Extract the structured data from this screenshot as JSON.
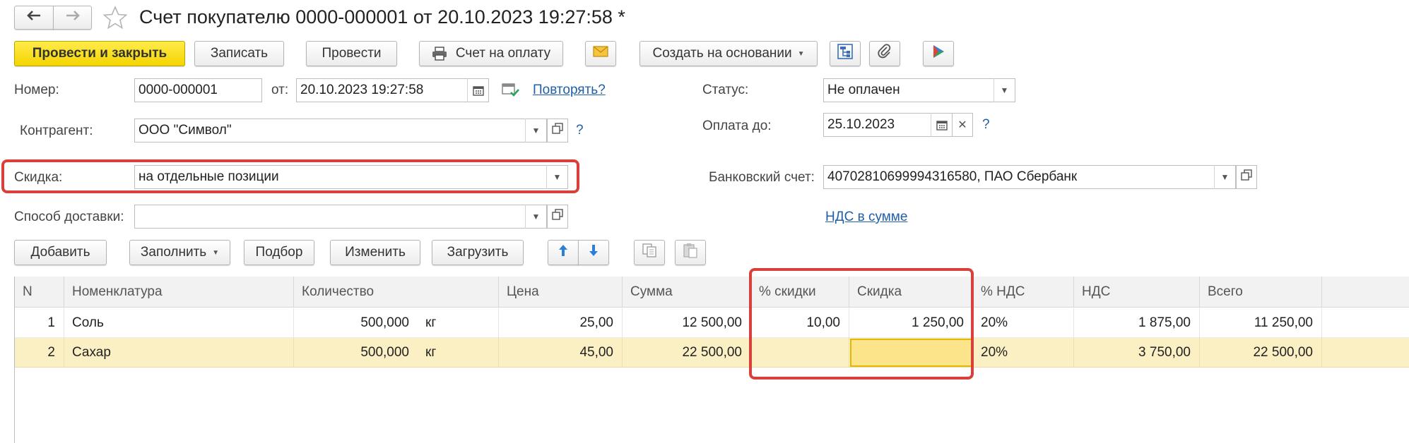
{
  "window": {
    "title": "Счет покупателю 0000-000001 от 20.10.2023 19:27:58 *"
  },
  "toolbar": {
    "post_close": "Провести и закрыть",
    "save": "Записать",
    "post": "Провести",
    "print_invoice": "Счет на оплату",
    "create_based": "Создать на основании"
  },
  "form": {
    "number_label": "Номер:",
    "number_value": "0000-000001",
    "date_label": "от:",
    "date_value": "20.10.2023 19:27:58",
    "repeat_link": "Повторять?",
    "status_label": "Статус:",
    "status_value": "Не оплачен",
    "counterparty_label": "Контрагент:",
    "counterparty_value": "ООО \"Символ\"",
    "payment_due_label": "Оплата до:",
    "payment_due_value": "25.10.2023",
    "discount_label": "Скидка:",
    "discount_value": "на отдельные позиции",
    "bank_account_label": "Банковский счет:",
    "bank_account_value": "40702810699994316580, ПАО Сбербанк",
    "delivery_label": "Способ доставки:",
    "delivery_value": "",
    "vat_link": "НДС в сумме",
    "help": "?"
  },
  "table_toolbar": {
    "add": "Добавить",
    "fill": "Заполнить",
    "select": "Подбор",
    "change": "Изменить",
    "load": "Загрузить"
  },
  "table": {
    "columns": [
      "N",
      "Номенклатура",
      "Количество",
      "Цена",
      "Сумма",
      "% скидки",
      "Скидка",
      "% НДС",
      "НДС",
      "Всего"
    ],
    "rows": [
      {
        "n": "1",
        "item": "Соль",
        "qty": "500,000",
        "unit": "кг",
        "price": "25,00",
        "sum": "12 500,00",
        "disc_pct": "10,00",
        "disc": "1 250,00",
        "vat_pct": "20%",
        "vat": "1 875,00",
        "total": "11 250,00"
      },
      {
        "n": "2",
        "item": "Сахар",
        "qty": "500,000",
        "unit": "кг",
        "price": "45,00",
        "sum": "22 500,00",
        "disc_pct": "",
        "disc": "",
        "vat_pct": "20%",
        "vat": "3 750,00",
        "total": "22 500,00"
      }
    ]
  },
  "colors": {
    "accent_yellow": "#f4d400",
    "highlight_red": "#d9403a",
    "selected_row": "#fbf0c4",
    "link_blue": "#1f5fa8"
  }
}
